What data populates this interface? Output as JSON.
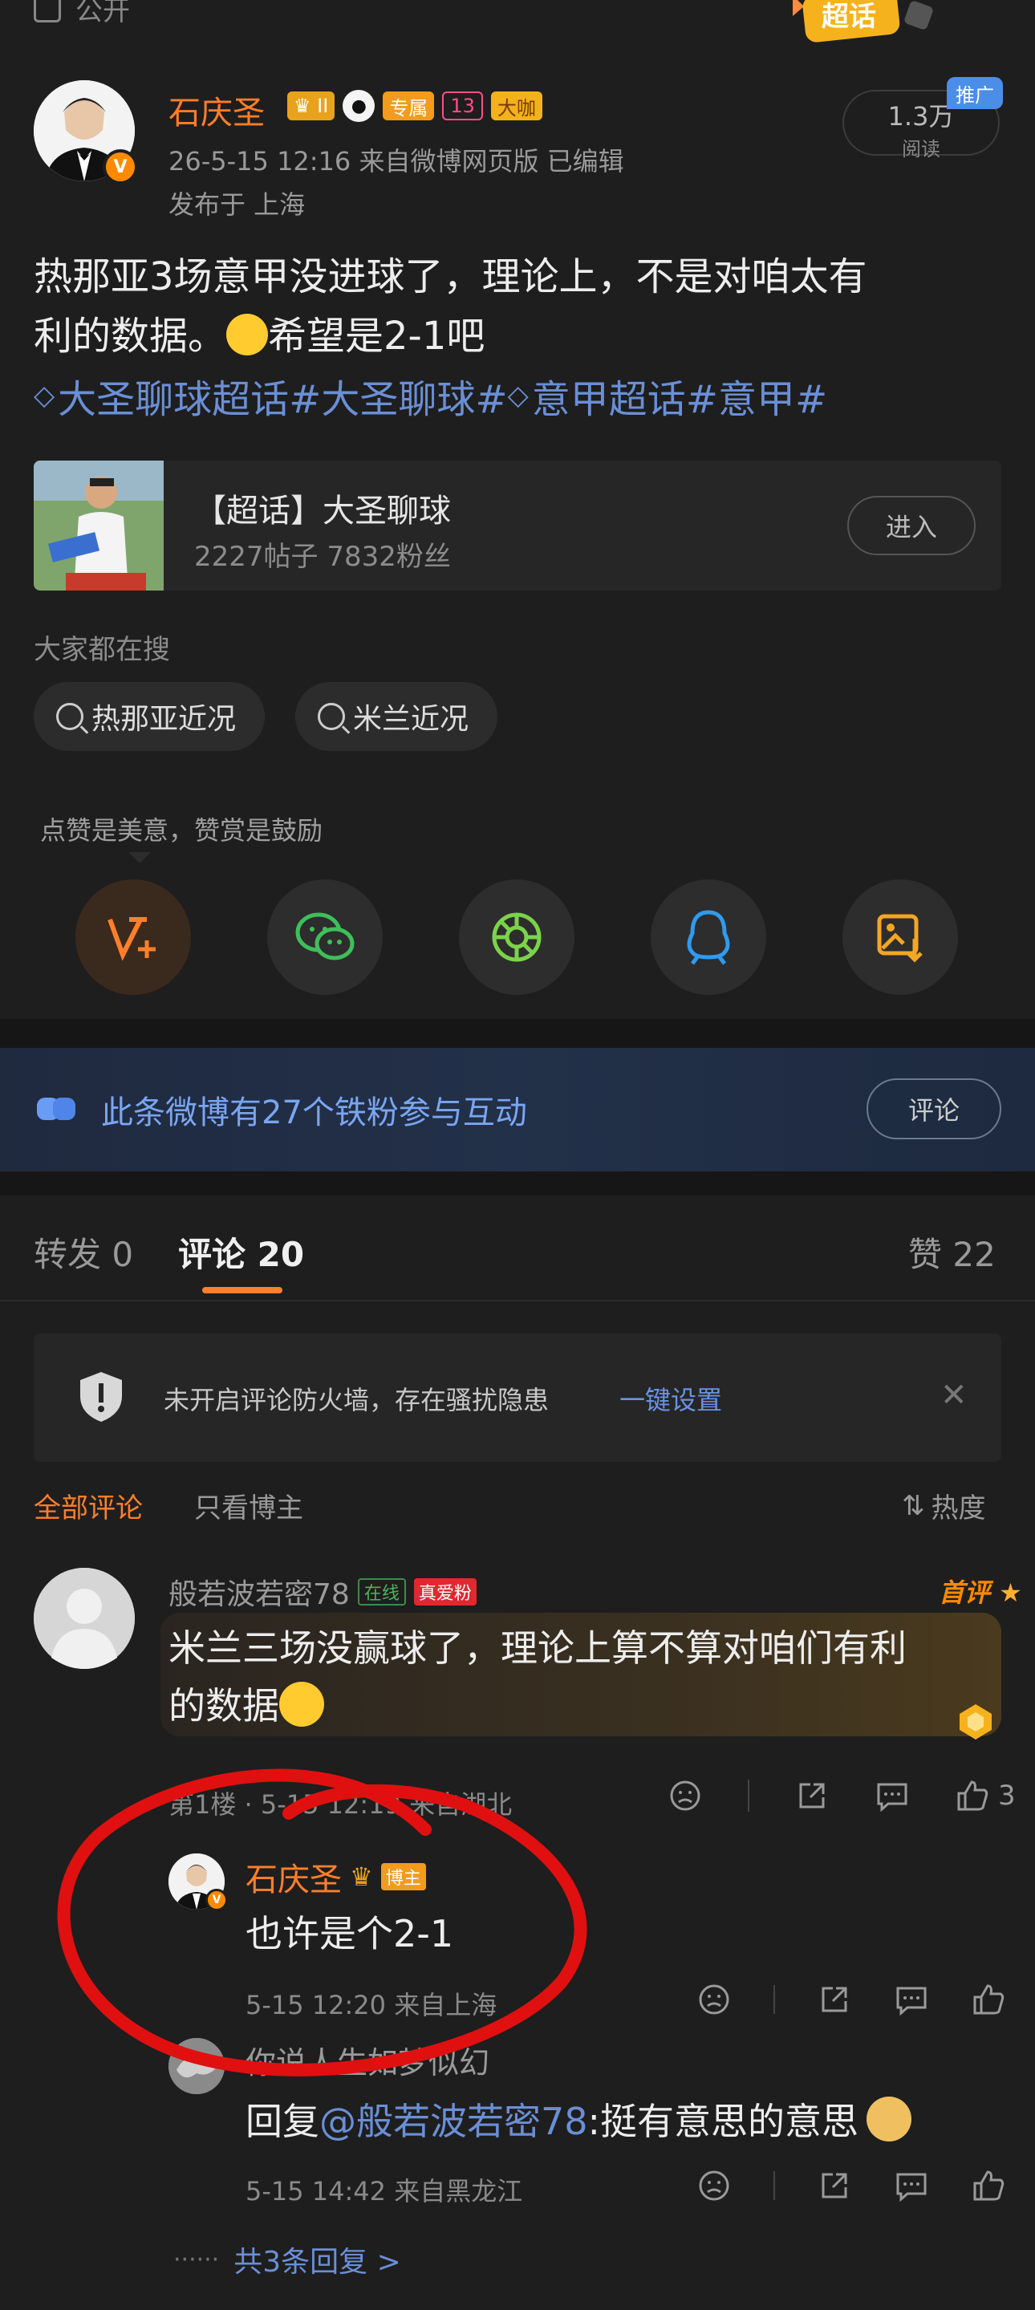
{
  "top": {
    "partial_label": "公开",
    "super_badge": "超话"
  },
  "post": {
    "author": "石庆圣",
    "badges": {
      "vip_level": "II",
      "zhuanshu": "专属",
      "level": "13",
      "daka": "大咖"
    },
    "verified_badge": "V",
    "meta": "26-5-15 12:16  来自微博网页版  已编辑",
    "location": "发布于 上海",
    "reads_value": "1.3万",
    "reads_label": "阅读",
    "promo_badge": "推广",
    "text_line1": "热那亚3场意甲没进球了，理论上，不是对咱太有",
    "text_line2a": "利的数据。",
    "text_line2b": "希望是2-1吧",
    "tags": [
      "大圣聊球超话",
      "#大圣聊球#",
      "意甲超话",
      "#意甲#"
    ]
  },
  "supertopic": {
    "title": "【超话】大圣聊球",
    "stats": "2227帖子  7832粉丝",
    "enter_label": "进入"
  },
  "search": {
    "label": "大家都在搜",
    "items": [
      "热那亚近况",
      "米兰近况"
    ]
  },
  "reward_tip": "点赞是美意，赞赏是鼓励",
  "share_icons": [
    "reward-icon",
    "wechat-icon",
    "moments-icon",
    "qq-icon",
    "save-image-icon"
  ],
  "iron_fans": {
    "text": "此条微博有27个铁粉参与互动",
    "button": "评论"
  },
  "tabs": {
    "repost": "转发 0",
    "comment": "评论 20",
    "like": "赞 22"
  },
  "firewall": {
    "text": "未开启评论防火墙，存在骚扰隐患",
    "link": "一键设置"
  },
  "filters": {
    "all": "全部评论",
    "author_only": "只看博主",
    "sort": "热度"
  },
  "comment": {
    "author": "般若波若密78",
    "online_badge": "在线",
    "fan_badge": "真爱粉",
    "first_label": "首评",
    "text_line1": "米兰三场没赢球了，理论上算不算对咱们有利",
    "text_line2": "的数据",
    "meta": "第1楼 · 5-15 12:19  来自湖北",
    "like_count": "3"
  },
  "reply1": {
    "author": "石庆圣",
    "role_badge": "博主",
    "text": "也许是个2-1",
    "meta": "5-15 12:20  来自上海"
  },
  "reply2": {
    "author": "你说人生如梦似幻",
    "text_prefix": "回复",
    "mention": "@般若波若密78",
    "text_suffix": ":挺有意思的意思",
    "meta": "5-15 14:42  来自黑龙江"
  },
  "more_replies": {
    "dots": "······",
    "label": "共3条回复 >"
  },
  "colors": {
    "accent": "#ff7f2a",
    "link": "#6a8fd6",
    "bg": "#1e1e1e",
    "annotation": "#e01010"
  }
}
